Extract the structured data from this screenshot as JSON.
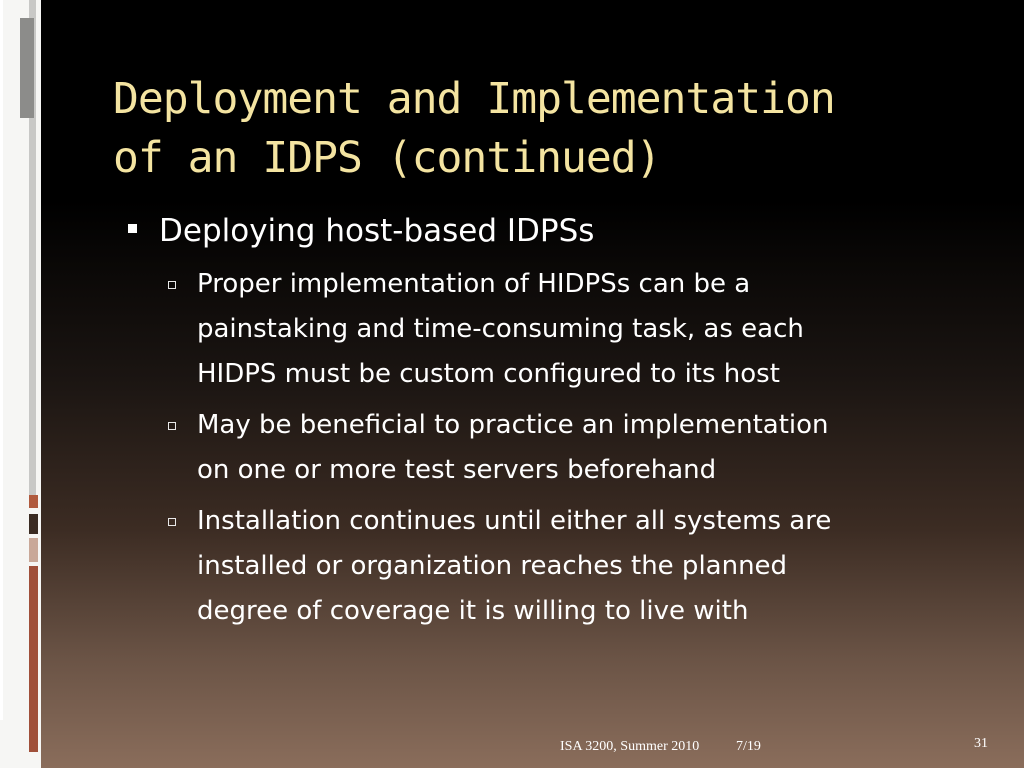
{
  "slide": {
    "title_lines": [
      "Deployment and Implementation",
      "of an IDPS (continued)"
    ],
    "bullet": "Deploying host-based IDPSs",
    "subbullets": [
      {
        "lines": [
          "Proper implementation of HIDPSs can be a",
          "painstaking and time-consuming task, as each",
          "HIDPS must be custom configured to its host"
        ]
      },
      {
        "lines": [
          "May be beneficial to practice an implementation",
          "on one or more test servers beforehand"
        ]
      },
      {
        "lines": [
          "Installation continues until either all systems are",
          "installed or organization reaches the planned",
          "degree of coverage it is willing to live with"
        ]
      }
    ]
  },
  "footer": {
    "course": "ISA 3200, Summer 2010",
    "date": "7/19",
    "page_number": "31"
  },
  "colors": {
    "title": "#f4e4a1",
    "accent": "#a0503a"
  }
}
